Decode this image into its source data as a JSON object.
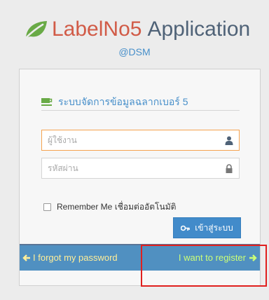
{
  "header": {
    "title_part1": "LabelNo5",
    "title_part2": "Application",
    "subtitle": "@DSM"
  },
  "login": {
    "system_title": "ระบบจัดการข้อมูลฉลากเบอร์ 5",
    "username_placeholder": "ผู้ใช้งาน",
    "password_placeholder": "รหัสผ่าน",
    "remember_label": "Remember Me เชื่อมต่ออัตโนมัติ",
    "login_button": "เข้าสู่ระบบ"
  },
  "toolbar": {
    "forgot_label": "I forgot my password",
    "register_label": "I want to register"
  },
  "colors": {
    "brand_red": "#d15b47",
    "brand_blue": "#478fca",
    "leaf_green": "#69aa46",
    "toolbar_blue": "#5090c1",
    "forgot_yellow": "#ffee99",
    "register_green": "#ccff77",
    "highlight_red": "#e0201e"
  },
  "icons": {
    "logo": "leaf-icon",
    "system_title": "coffee-icon",
    "username": "user-icon",
    "password": "lock-icon",
    "login": "key-icon",
    "forgot": "arrow-left-icon",
    "register": "arrow-right-icon"
  }
}
